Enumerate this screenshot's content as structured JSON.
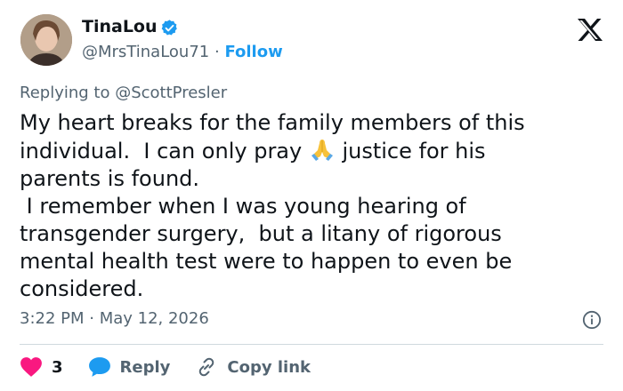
{
  "author": {
    "name": "TinaLou",
    "handle": "@MrsTinaLou71",
    "separator": "·",
    "follow_label": "Follow"
  },
  "reply": {
    "prefix": "Replying to ",
    "mention": "@ScottPresler"
  },
  "tweet": {
    "line1": "My heart breaks for the family members of this",
    "line2a": "individual.  I can only pray ",
    "emoji": "folded-hands-emoji",
    "line2b": " justice for his",
    "line3": "parents is found.",
    "line4": " I remember when I was young hearing of",
    "line5": "transgender surgery,  but a litany of rigorous",
    "line6": "mental health test were to happen to even be",
    "line7": "considered."
  },
  "meta": {
    "timestamp": "3:22 PM · May 12, 2026"
  },
  "actions": {
    "likes": "3",
    "reply_label": "Reply",
    "copy_label": "Copy link"
  },
  "colors": {
    "accent": "#1d9bf0",
    "like": "#f91880",
    "muted": "#536471",
    "text": "#0f1419"
  },
  "icons": [
    "verified-badge-icon",
    "x-logo-icon",
    "info-icon",
    "heart-icon",
    "reply-bubble-icon",
    "link-icon"
  ]
}
